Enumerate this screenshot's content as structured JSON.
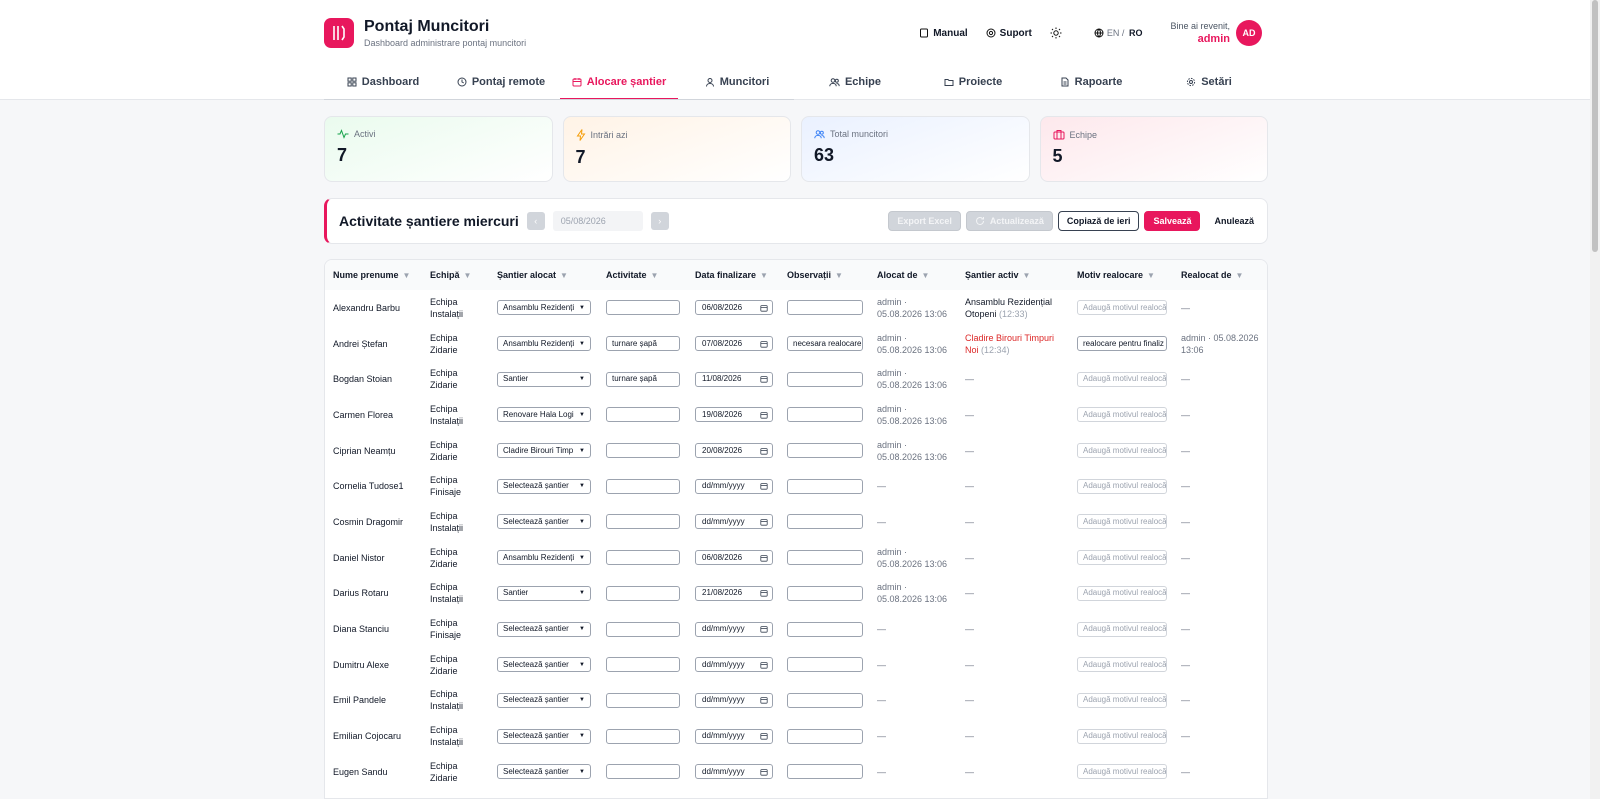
{
  "app": {
    "title": "Pontaj Muncitori",
    "subtitle": "Dashboard administrare pontaj muncitori",
    "accent": "#e8175d"
  },
  "header": {
    "manual": "Manual",
    "support": "Suport",
    "lang_en": "EN",
    "lang_sep": "/",
    "lang_ro": "RO",
    "welcome": "Bine ai revenit,",
    "user": "admin",
    "avatar": "AD"
  },
  "tabs": [
    {
      "label": "Dashboard",
      "icon": "grid-icon"
    },
    {
      "label": "Pontaj remote",
      "icon": "clock-icon"
    },
    {
      "label": "Alocare șantier",
      "icon": "calendar-icon",
      "active": true
    },
    {
      "label": "Muncitori",
      "icon": "user-icon"
    },
    {
      "label": "Echipe",
      "icon": "users-icon"
    },
    {
      "label": "Proiecte",
      "icon": "folder-icon"
    },
    {
      "label": "Rapoarte",
      "icon": "file-icon"
    },
    {
      "label": "Setări",
      "icon": "gear-icon"
    }
  ],
  "stats": [
    {
      "label": "Activi",
      "value": "7",
      "icon": "activity-icon",
      "color": "#16a34a"
    },
    {
      "label": "Intrări azi",
      "value": "7",
      "icon": "bolt-icon",
      "color": "#f59e0b"
    },
    {
      "label": "Total muncitori",
      "value": "63",
      "icon": "users-icon",
      "color": "#3b82f6"
    },
    {
      "label": "Echipe",
      "value": "5",
      "icon": "briefcase-icon",
      "color": "#e8175d"
    }
  ],
  "toolbar": {
    "title": "Activitate șantiere miercuri",
    "prev": "‹",
    "next": "›",
    "date": "05/08/2026",
    "export": "Export Excel",
    "refresh": "Actualizează",
    "copy": "Copiază de ieri",
    "save": "Salvează",
    "cancel": "Anulează"
  },
  "table": {
    "columns": [
      "Nume prenume",
      "Echipă",
      "Șantier alocat",
      "Activitate",
      "Data finalizare",
      "Observații",
      "Alocat de",
      "Șantier activ",
      "Motiv realocare",
      "Realocat de"
    ],
    "motiv_placeholder": "Adaugă motivul realocă",
    "dash": "—",
    "rows": [
      {
        "name": "Alexandru Barbu",
        "team": [
          "Echipa",
          "Instalații"
        ],
        "site": "Ansamblu Rezidenți",
        "activity": "",
        "date": "06/08/2026",
        "obs": "",
        "alloc": [
          "admin ·",
          "05.08.2026 13:06"
        ],
        "active_site": "Ansamblu Rezidențial Otopeni",
        "active_time": "(12:33)",
        "active_red": false,
        "motiv": "",
        "realloc": ""
      },
      {
        "name": "Andrei Ștefan",
        "team": [
          "Echipa",
          "Zidarie"
        ],
        "site": "Ansamblu Rezidenți",
        "activity": "turnare șapă",
        "date": "07/08/2026",
        "obs": "necesara realocare",
        "alloc": [
          "admin ·",
          "05.08.2026 13:06"
        ],
        "active_site": "Cladire Birouri Timpuri Noi",
        "active_time": "(12:34)",
        "active_red": true,
        "motiv": "realocare pentru finaliz",
        "realloc": [
          "admin · 05.08.2026",
          "13:06"
        ]
      },
      {
        "name": "Bogdan Stoian",
        "team": [
          "Echipa",
          "Zidarie"
        ],
        "site": "Santier",
        "activity": "turnare șapă",
        "date": "11/08/2026",
        "obs": "",
        "alloc": [
          "admin ·",
          "05.08.2026 13:06"
        ],
        "active_site": "",
        "active_time": "",
        "active_red": false,
        "motiv": "",
        "realloc": ""
      },
      {
        "name": "Carmen Florea",
        "team": [
          "Echipa",
          "Instalații"
        ],
        "site": "Renovare Hala Logi",
        "activity": "",
        "date": "19/08/2026",
        "obs": "",
        "alloc": [
          "admin ·",
          "05.08.2026 13:06"
        ],
        "active_site": "",
        "active_time": "",
        "active_red": false,
        "motiv": "",
        "realloc": ""
      },
      {
        "name": "Ciprian Neamțu",
        "team": [
          "Echipa",
          "Zidarie"
        ],
        "site": "Cladire Birouri Timp",
        "activity": "",
        "date": "20/08/2026",
        "obs": "",
        "alloc": [
          "admin ·",
          "05.08.2026 13:06"
        ],
        "active_site": "",
        "active_time": "",
        "active_red": false,
        "motiv": "",
        "realloc": ""
      },
      {
        "name": "Cornelia Tudose1",
        "team": [
          "Echipa",
          "Finisaje"
        ],
        "site": "Selectează șantier",
        "activity": "",
        "date": "dd/mm/yyyy",
        "obs": "",
        "alloc": "",
        "active_site": "",
        "active_time": "",
        "active_red": false,
        "motiv": "",
        "realloc": ""
      },
      {
        "name": "Cosmin Dragomir",
        "team": [
          "Echipa",
          "Instalații"
        ],
        "site": "Selectează șantier",
        "activity": "",
        "date": "dd/mm/yyyy",
        "obs": "",
        "alloc": "",
        "active_site": "",
        "active_time": "",
        "active_red": false,
        "motiv": "",
        "realloc": ""
      },
      {
        "name": "Daniel Nistor",
        "team": [
          "Echipa",
          "Zidarie"
        ],
        "site": "Ansamblu Rezidenți",
        "activity": "",
        "date": "06/08/2026",
        "obs": "",
        "alloc": [
          "admin ·",
          "05.08.2026 13:06"
        ],
        "active_site": "",
        "active_time": "",
        "active_red": false,
        "motiv": "",
        "realloc": ""
      },
      {
        "name": "Darius Rotaru",
        "team": [
          "Echipa",
          "Instalații"
        ],
        "site": "Santier",
        "activity": "",
        "date": "21/08/2026",
        "obs": "",
        "alloc": [
          "admin ·",
          "05.08.2026 13:06"
        ],
        "active_site": "",
        "active_time": "",
        "active_red": false,
        "motiv": "",
        "realloc": ""
      },
      {
        "name": "Diana Stanciu",
        "team": [
          "Echipa",
          "Finisaje"
        ],
        "site": "Selectează șantier",
        "activity": "",
        "date": "dd/mm/yyyy",
        "obs": "",
        "alloc": "",
        "active_site": "",
        "active_time": "",
        "active_red": false,
        "motiv": "",
        "realloc": ""
      },
      {
        "name": "Dumitru Alexe",
        "team": [
          "Echipa",
          "Zidarie"
        ],
        "site": "Selectează șantier",
        "activity": "",
        "date": "dd/mm/yyyy",
        "obs": "",
        "alloc": "",
        "active_site": "",
        "active_time": "",
        "active_red": false,
        "motiv": "",
        "realloc": ""
      },
      {
        "name": "Emil Pandele",
        "team": [
          "Echipa",
          "Instalații"
        ],
        "site": "Selectează șantier",
        "activity": "",
        "date": "dd/mm/yyyy",
        "obs": "",
        "alloc": "",
        "active_site": "",
        "active_time": "",
        "active_red": false,
        "motiv": "",
        "realloc": ""
      },
      {
        "name": "Emilian Cojocaru",
        "team": [
          "Echipa",
          "Instalații"
        ],
        "site": "Selectează șantier",
        "activity": "",
        "date": "dd/mm/yyyy",
        "obs": "",
        "alloc": "",
        "active_site": "",
        "active_time": "",
        "active_red": false,
        "motiv": "",
        "realloc": ""
      },
      {
        "name": "Eugen Sandu",
        "team": [
          "Echipa",
          "Zidarie"
        ],
        "site": "Selectează șantier",
        "activity": "",
        "date": "dd/mm/yyyy",
        "obs": "",
        "alloc": "",
        "active_site": "",
        "active_time": "",
        "active_red": false,
        "motiv": "",
        "realloc": ""
      }
    ]
  }
}
